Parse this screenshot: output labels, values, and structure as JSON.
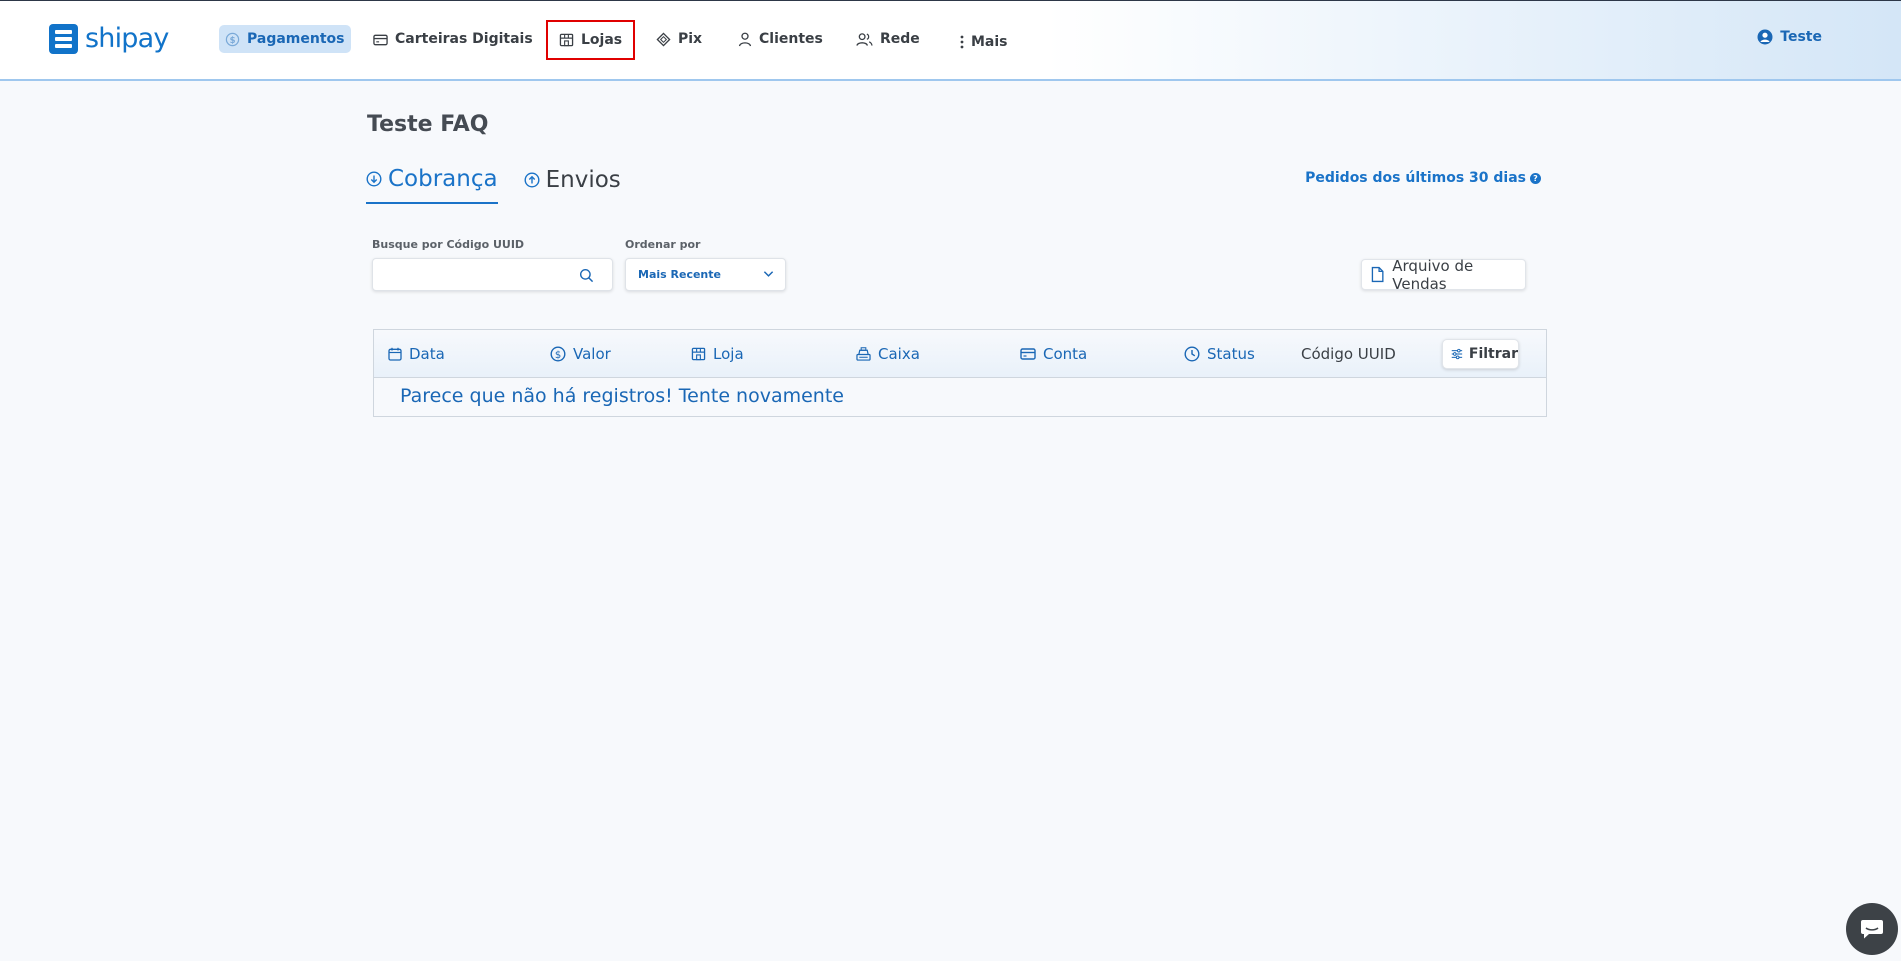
{
  "brand": {
    "name": "shipay"
  },
  "nav": {
    "items": [
      {
        "label": "Pagamentos",
        "icon": "dollar-circle-icon"
      },
      {
        "label": "Carteiras Digitais",
        "icon": "wallet-icon"
      },
      {
        "label": "Lojas",
        "icon": "store-icon"
      },
      {
        "label": "Pix",
        "icon": "pix-icon"
      },
      {
        "label": "Clientes",
        "icon": "user-icon"
      },
      {
        "label": "Rede",
        "icon": "users-icon"
      },
      {
        "label": "Mais",
        "icon": "more-vertical-icon"
      }
    ]
  },
  "user": {
    "name": "Teste"
  },
  "page": {
    "title": "Teste FAQ",
    "tabs": [
      {
        "label": "Cobrança",
        "icon": "arrow-down-circle-icon"
      },
      {
        "label": "Envios",
        "icon": "arrow-up-circle-icon"
      }
    ],
    "orders_link": "Pedidos dos últimos 30 dias",
    "help_mark": "?"
  },
  "filters": {
    "search_label": "Busque por Código UUID",
    "search_value": "",
    "sort_label": "Ordenar por",
    "sort_value": "Mais Recente"
  },
  "actions": {
    "sales_file": "Arquivo de Vendas"
  },
  "table": {
    "columns": [
      "Data",
      "Valor",
      "Loja",
      "Caixa",
      "Conta",
      "Status",
      "Código UUID"
    ],
    "filter_label": "Filtrar",
    "empty_message": "Parece que não há registros! Tente novamente"
  },
  "colors": {
    "primary": "#1a73c8",
    "highlight": "#e00000",
    "chat": "#3d4247"
  }
}
